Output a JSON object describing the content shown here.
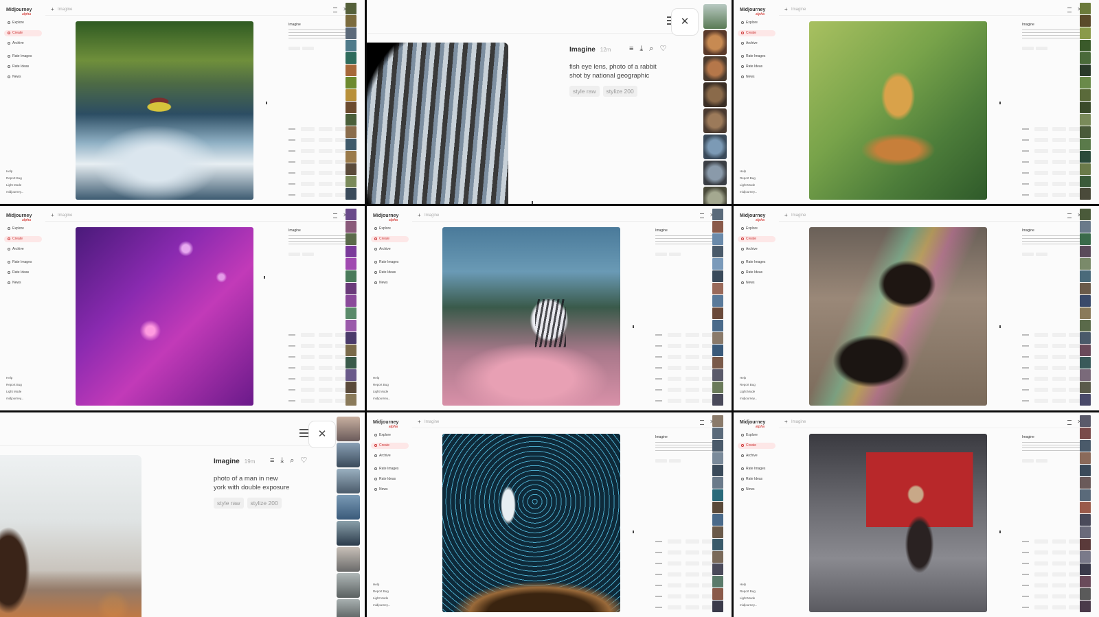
{
  "app": {
    "logo": "Midjourney",
    "logo_alpha": "alpha",
    "search_placeholder": "Imagine"
  },
  "sidebar": {
    "items": [
      "Explore",
      "Create",
      "Archive",
      "Rate Images",
      "Rate Ideas",
      "News"
    ],
    "bottom": [
      "Help",
      "Report Bug",
      "Light Mode",
      "midjourney..."
    ]
  },
  "panel_info_label": "Imagine",
  "zoom_panels": [
    {
      "title": "Imagine",
      "age": "12m",
      "prompt_lines": [
        "fish eye lens, photo of a rabbit",
        "shot by national geographic"
      ],
      "tags": [
        "style raw",
        "stylize 200"
      ]
    },
    {
      "title": "Imagine",
      "age": "19m",
      "prompt_lines": [
        "photo of a man in new",
        "york with double exposure"
      ],
      "tags": [
        "style raw",
        "stylize 200"
      ]
    }
  ],
  "icons": {
    "close": "close-icon",
    "filter": "filter-icon",
    "download": "download-icon",
    "search": "search-icon",
    "favorite": "heart-icon",
    "menu": "menu-icon"
  },
  "colors": {
    "accent": "#d9534f",
    "active_bg": "#fde7e7"
  }
}
